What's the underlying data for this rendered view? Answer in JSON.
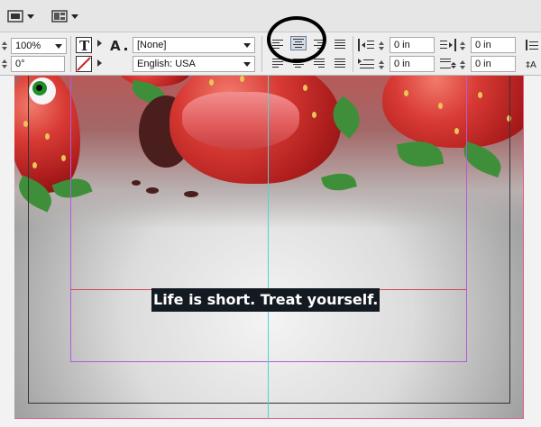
{
  "toolbar_top": {
    "screen_mode_icon": "screen-mode-icon",
    "view_options_icon": "view-options-icon"
  },
  "control": {
    "zoom_value": "100%",
    "rotation_value": "0°",
    "char_style_value": "[None]",
    "language_value": "English: USA",
    "left_indent_value": "0 in",
    "first_line_indent_value": "0 in",
    "right_indent_value": "0 in",
    "space_after_value": "0 in",
    "space_before_value": "0 in",
    "space_below_value": "0 in"
  },
  "alignment": {
    "selected": "align-center",
    "highlight_circle_color": "#000000"
  },
  "document": {
    "headline": "Life is short. Treat yourself.",
    "guide_color": "#4fd3d9",
    "column_guide_color": "#b25bd8",
    "margin_color": "#333333",
    "bleed_color": "#e85b8a",
    "text_highlight_color": "#141a22"
  }
}
